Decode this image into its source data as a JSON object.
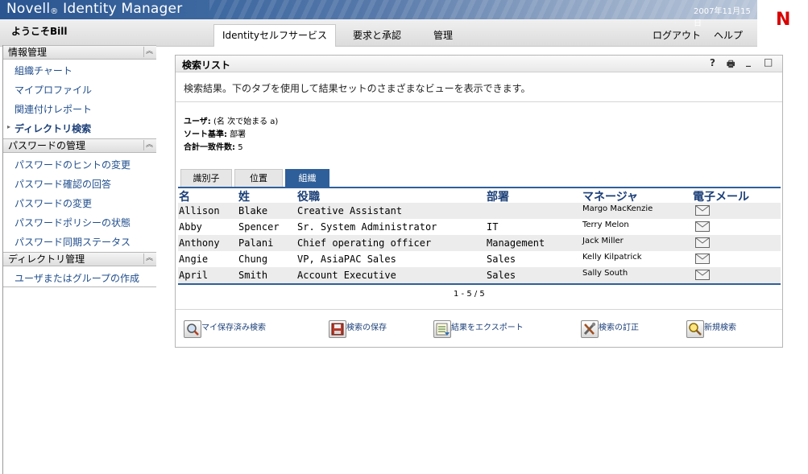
{
  "app": {
    "title": "Novell",
    "registered_mark": "®",
    "title_suffix": "Identity Manager",
    "date": "2007年11月15日",
    "logo_text": "N"
  },
  "header": {
    "welcome": "ようこそBill",
    "tabs": [
      {
        "label": "Identityセルフサービス",
        "active": true
      },
      {
        "label": "要求と承認",
        "active": false
      },
      {
        "label": "管理",
        "active": false
      }
    ],
    "logout": "ログアウト",
    "help": "ヘルプ"
  },
  "sidebar": {
    "sections": [
      {
        "title": "情報管理",
        "items": [
          {
            "label": "組織チャート",
            "current": false
          },
          {
            "label": "マイプロファイル",
            "current": false
          },
          {
            "label": "関連付けレポート",
            "current": false
          },
          {
            "label": "ディレクトリ検索",
            "current": true
          }
        ]
      },
      {
        "title": "パスワードの管理",
        "items": [
          {
            "label": "パスワードのヒントの変更"
          },
          {
            "label": "パスワード確認の回答"
          },
          {
            "label": "パスワードの変更"
          },
          {
            "label": "パスワードポリシーの状態"
          },
          {
            "label": "パスワード同期ステータス"
          }
        ]
      },
      {
        "title": "ディレクトリ管理",
        "items": [
          {
            "label": "ユーザまたはグループの作成"
          }
        ]
      }
    ],
    "collapse_glyph": "︽"
  },
  "portlet": {
    "title": "検索リスト",
    "controls": {
      "help": "?",
      "print": "🖶",
      "minimize": "_",
      "maximize": "□"
    },
    "description": "検索結果。下のタブを使用して結果セットのさまざまなビューを表示できます。",
    "criteria": [
      {
        "label": "ユーザ:",
        "value": "(名 次で始まる a)"
      },
      {
        "label": "ソート基準:",
        "value": "部署"
      },
      {
        "label": "合計一致件数:",
        "value": "5"
      }
    ],
    "tabs": [
      {
        "label": "識別子",
        "active": false
      },
      {
        "label": "位置",
        "active": false
      },
      {
        "label": "組織",
        "active": true
      }
    ],
    "columns": [
      "名",
      "姓",
      "役職",
      "部署",
      "マネージャ",
      "電子メール"
    ],
    "rows": [
      {
        "first": "Allison",
        "last": "Blake",
        "title": "Creative Assistant",
        "dept": "",
        "manager": "Margo MacKenzie",
        "email_icon": "envelope-icon"
      },
      {
        "first": "Abby",
        "last": "Spencer",
        "title": "Sr. System Administrator",
        "dept": "IT",
        "manager": "Terry Melon",
        "email_icon": "envelope-icon"
      },
      {
        "first": "Anthony",
        "last": "Palani",
        "title": "Chief operating officer",
        "dept": "Management",
        "manager": "Jack Miller",
        "email_icon": "envelope-icon"
      },
      {
        "first": "Angie",
        "last": "Chung",
        "title": "VP, AsiaPAC Sales",
        "dept": "Sales",
        "manager": "Kelly Kilpatrick",
        "email_icon": "envelope-icon"
      },
      {
        "first": "April",
        "last": "Smith",
        "title": "Account Executive",
        "dept": "Sales",
        "manager": "Sally South",
        "email_icon": "envelope-icon"
      }
    ],
    "pager": "1 - 5 / 5",
    "actions": [
      {
        "label": "マイ保存済み検索",
        "icon": "saved-search-icon"
      },
      {
        "label": "検索の保存",
        "icon": "save-disk-icon"
      },
      {
        "label": "結果をエクスポート",
        "icon": "export-list-icon"
      },
      {
        "label": "検索の訂正",
        "icon": "refine-tools-icon"
      },
      {
        "label": "新規検索",
        "icon": "new-search-icon"
      }
    ]
  },
  "colors": {
    "accent": "#2f5f9a",
    "link": "#1f4d8c",
    "brand_red": "#d80000",
    "header_blue": "#2a5590"
  }
}
